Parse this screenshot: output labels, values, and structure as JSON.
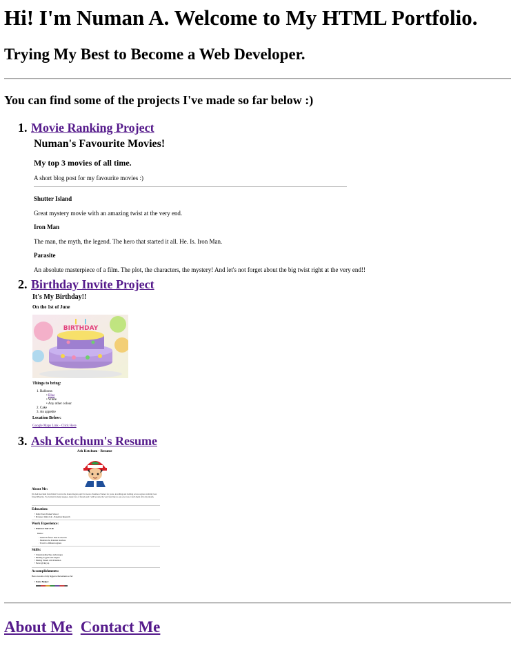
{
  "header": {
    "title": "Hi! I'm Numan A. Welcome to My HTML Portfolio.",
    "subtitle": "Trying My Best to Become a Web Developer."
  },
  "intro": "You can find some of the projects I've made so far below :)",
  "projects": [
    {
      "number": "1.",
      "title": "Movie Ranking Project",
      "preview": {
        "heading": "Numan's Favourite Movies!",
        "subheading": "My top 3 movies of all time.",
        "intro": "A short blog post for my favourite movies :)",
        "movies": [
          {
            "name": "Shutter Island",
            "desc": "Great mystery movie with an amazing twist at the very end."
          },
          {
            "name": "Iron Man",
            "desc": "The man, the myth, the legend. The hero that started it all. He. Is. Iron Man."
          },
          {
            "name": "Parasite",
            "desc": "An absolute masterpiece of a film. The plot, the characters, the mystery! And let's not forget about the big twist right at the very end!!"
          }
        ]
      }
    },
    {
      "number": "2.",
      "title": "Birthday Invite Project",
      "preview": {
        "heading": "It's My Birthday!!",
        "date": "On the 1st of June",
        "things_heading": "Things to bring:",
        "items": [
          "Balloons",
          "Cake",
          "An appetite"
        ],
        "balloon_colors": [
          "Blue",
          "White",
          "Any other colour"
        ],
        "location_heading": "Location Below:",
        "map_link": "Google Maps Link - Click Here"
      }
    },
    {
      "number": "3.",
      "title": "Ash Ketchum's Resume",
      "preview": {
        "heading": "Ash Ketchum - Resume",
        "about_heading": "About Me:",
        "about_text": "I'm Ash Ketchum from Pallet Town in the Kanto Region and I've been a Pokémon Trainer for years, travelling and battling across regions with my best friend Pikachu. I've battled in many leagues, made lots of friends and I will become the very best like no one ever was. Catch them all is my dream.",
        "education_heading": "Education:",
        "education": [
          "Pallet Town Trainer School",
          "Professor Oak's Lab - Pokemon Research"
        ],
        "experience_heading": "Work Experience:",
        "experience_role": "Professor Oak's Lab",
        "experience_intro": "Duties:",
        "experience_items": [
          "Assist Professor Oak in research",
          "Maintain the Pokédex database",
          "Travel to different regions"
        ],
        "skills_heading": "Skills:",
        "skills": [
          "Understanding Type Advantages",
          "Battling in gyms and leagues",
          "Making friends with Pokémon",
          "Never giving up"
        ],
        "accomplishments_heading": "Accomplishments:",
        "accomplishments_text": "Here are some of my biggest achievements so far:",
        "badges_label": "Kanto Badges:"
      }
    }
  ],
  "footer": {
    "about": "About Me",
    "contact": "Contact Me"
  }
}
